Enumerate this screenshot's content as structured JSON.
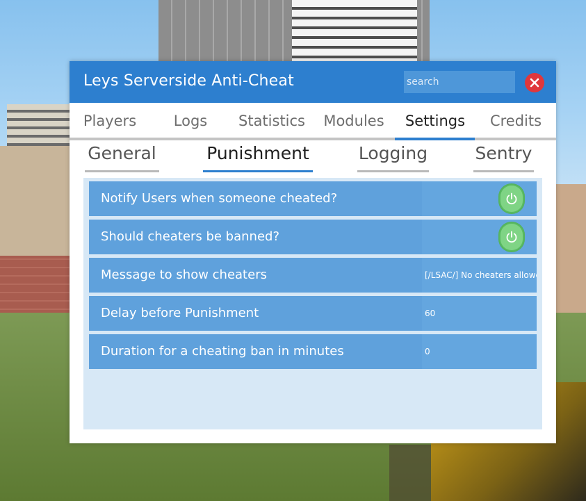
{
  "window": {
    "title": "Leys Serverside Anti-Cheat",
    "search_placeholder": "search"
  },
  "tabs": [
    {
      "label": "Players"
    },
    {
      "label": "Logs"
    },
    {
      "label": "Statistics"
    },
    {
      "label": "Modules"
    },
    {
      "label": "Settings",
      "active": true
    },
    {
      "label": "Credits"
    }
  ],
  "subtabs": [
    {
      "label": "General"
    },
    {
      "label": "Punishment",
      "active": true
    },
    {
      "label": "Logging"
    },
    {
      "label": "Sentry"
    }
  ],
  "settings": [
    {
      "label": "Notify Users when someone cheated?",
      "type": "toggle",
      "enabled": true
    },
    {
      "label": "Should cheaters be banned?",
      "type": "toggle",
      "enabled": true
    },
    {
      "label": "Message to show cheaters",
      "type": "text",
      "value": "[/LSAC/] No cheaters allowe"
    },
    {
      "label": "Delay before Punishment",
      "type": "text",
      "value": "60"
    },
    {
      "label": "Duration for a cheating ban in minutes",
      "type": "text",
      "value": "0"
    }
  ],
  "colors": {
    "accent": "#2d7fcf",
    "row": "#5fa1dc",
    "panel": "#d7e8f6",
    "toggle_on": "#5fbf67",
    "close": "#e0373c"
  },
  "icons": {
    "close": "close-icon",
    "toggle": "power-icon"
  }
}
